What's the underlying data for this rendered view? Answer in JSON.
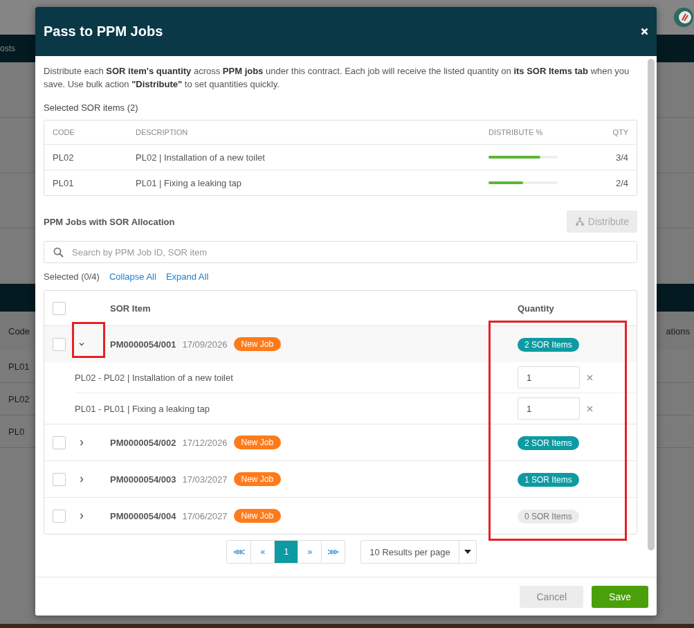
{
  "background": {
    "nav_tab": "osts",
    "header_cells": [
      "Code",
      "ations"
    ],
    "rows": [
      "PL01",
      "PL02",
      "PL0"
    ]
  },
  "dialog": {
    "title": "Pass to PPM Jobs",
    "intro": "Distribute each **SOR item's quantity** across **PPM jobs** under this contract. Each job will receive the listed quantity on **its SOR Items tab** when you save. Use bulk action **\"Distribute\"** to set quantities quickly.",
    "selected_items": {
      "heading": "Selected SOR items (2)",
      "columns": [
        "CODE",
        "DESCRIPTION",
        "DISTRIBUTE %",
        "QTY"
      ],
      "rows": [
        {
          "code": "PL02",
          "description": "PL02 | Installation of a new toilet",
          "level": 0.75,
          "qty": "3/4"
        },
        {
          "code": "PL01",
          "description": "PL01 | Fixing a leaking tap",
          "level": 0.5,
          "qty": "2/4"
        }
      ]
    },
    "allocation": {
      "heading": "PPM Jobs with SOR Allocation",
      "distribute_button": {
        "label": "Distribute",
        "disabled": true
      },
      "search": {
        "placeholder": "Search by PPM Job ID, SOR item"
      },
      "selected_count": "Selected (0/4)",
      "links": [
        "Collapse All",
        "Expand All"
      ],
      "columns": [
        "SOR Item",
        "Quantity"
      ],
      "all_checked": false,
      "jobs": [
        {
          "id": "PM0000054/001",
          "date": "17/09/2026",
          "status": "New Job",
          "count": "2 SOR Items",
          "empty": false,
          "checked": false,
          "expanded": true,
          "items": [
            {
              "label": "PL02 - PL02 | Installation of a new toilet",
              "value": "1"
            },
            {
              "label": "PL01 - PL01 | Fixing a leaking tap",
              "value": "1"
            }
          ]
        },
        {
          "id": "PM0000054/002",
          "date": "17/12/2026",
          "status": "New Job",
          "count": "2 SOR Items",
          "empty": false,
          "checked": false,
          "expanded": false
        },
        {
          "id": "PM0000054/003",
          "date": "17/03/2027",
          "status": "New Job",
          "count": "1 SOR Items",
          "empty": false,
          "checked": false,
          "expanded": false
        },
        {
          "id": "PM0000054/004",
          "date": "17/06/2027",
          "status": "New Job",
          "count": "0 SOR Items",
          "empty": true,
          "checked": false,
          "expanded": false
        }
      ],
      "pagination": {
        "pages": [
          {
            "label": "⋘",
            "selected": false
          },
          {
            "label": "«",
            "selected": false
          },
          {
            "label": "1",
            "selected": true
          },
          {
            "label": "»",
            "selected": false
          },
          {
            "label": "⋙",
            "selected": false
          }
        ],
        "per_page": "10 Results per page"
      }
    },
    "buttons": [
      {
        "label": "Cancel",
        "kind": "secondary"
      },
      {
        "label": "Save",
        "kind": "primary"
      }
    ]
  },
  "highlights": {
    "expand_toggle": true,
    "quantity_column": true
  }
}
